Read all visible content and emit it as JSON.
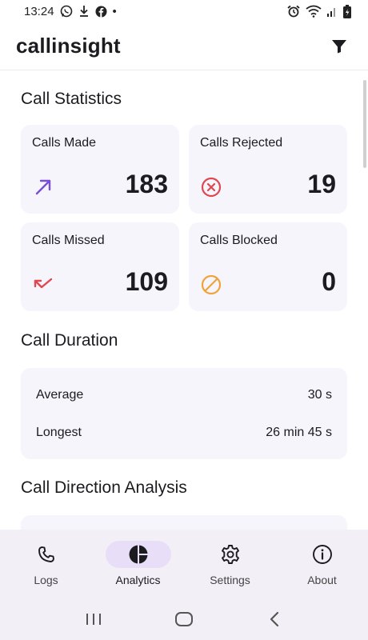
{
  "status_bar": {
    "time": "13:24",
    "dot": "•"
  },
  "app_bar": {
    "title": "callinsight",
    "filter_icon": "filter-icon"
  },
  "sections": {
    "statistics": "Call Statistics",
    "duration": "Call Duration",
    "direction": "Call Direction Analysis"
  },
  "stats": [
    {
      "label": "Calls Made",
      "value": "183",
      "icon": "outgoing-call-icon",
      "color": "#7b4dd6"
    },
    {
      "label": "Calls Rejected",
      "value": "19",
      "icon": "rejected-call-icon",
      "color": "#e0474f"
    },
    {
      "label": "Calls Missed",
      "value": "109",
      "icon": "missed-call-icon",
      "color": "#e0474f"
    },
    {
      "label": "Calls Blocked",
      "value": "0",
      "icon": "blocked-call-icon",
      "color": "#f0a33a"
    }
  ],
  "duration": {
    "average_label": "Average",
    "average_value": "30 s",
    "longest_label": "Longest",
    "longest_value": "26 min 45 s"
  },
  "bottom_nav": [
    {
      "label": "Logs",
      "icon": "phone-icon",
      "active": false
    },
    {
      "label": "Analytics",
      "icon": "pie-chart-icon",
      "active": true
    },
    {
      "label": "Settings",
      "icon": "gear-icon",
      "active": false
    },
    {
      "label": "About",
      "icon": "info-icon",
      "active": false
    }
  ],
  "system_nav": [
    "recents-icon",
    "home-icon",
    "back-icon"
  ]
}
